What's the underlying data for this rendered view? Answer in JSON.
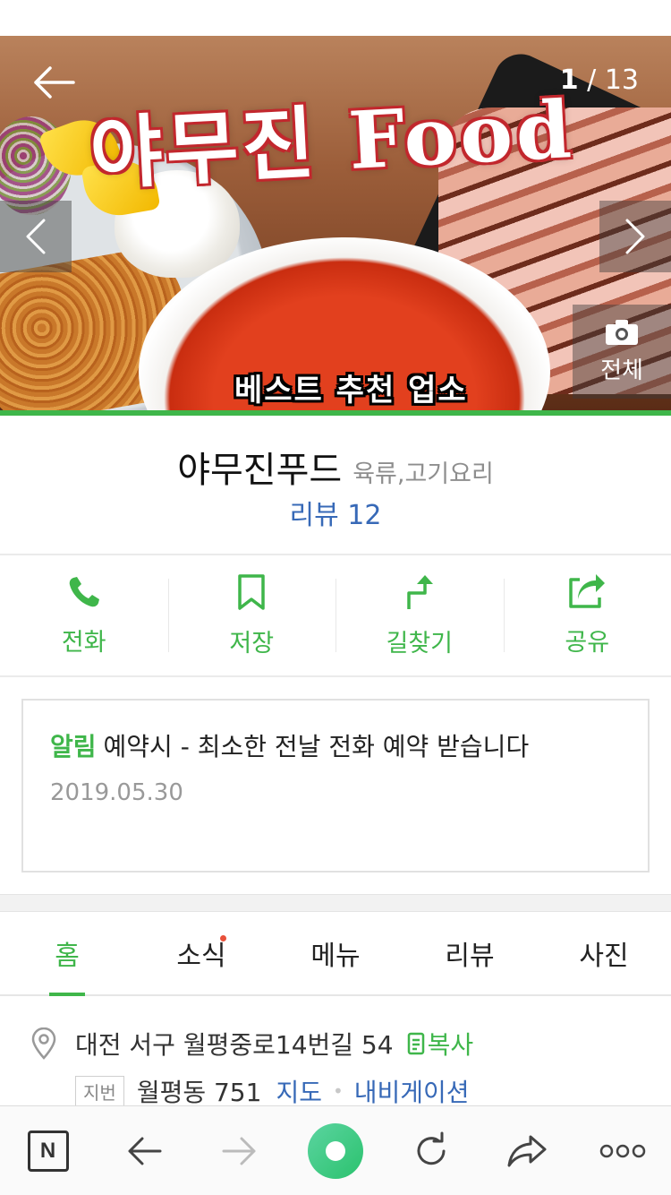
{
  "hero": {
    "title_art": "야무진 Food",
    "caption": "베스트 추천 업소",
    "counter_current": "1",
    "counter_total": "13",
    "all_photos_label": "전체"
  },
  "place": {
    "name": "야무진푸드",
    "category": "육류,고기요리",
    "review_link": "리뷰 12"
  },
  "actions": [
    {
      "label": "전화",
      "icon": "phone-icon"
    },
    {
      "label": "저장",
      "icon": "bookmark-icon"
    },
    {
      "label": "길찾기",
      "icon": "directions-icon"
    },
    {
      "label": "공유",
      "icon": "share-icon"
    }
  ],
  "notice": {
    "tag": "알림",
    "text": "예약시 - 최소한 전날 전화 예약 받습니다",
    "date": "2019.05.30"
  },
  "tabs": [
    {
      "label": "홈",
      "active": true
    },
    {
      "label": "소식",
      "badge": true
    },
    {
      "label": "메뉴"
    },
    {
      "label": "리뷰"
    },
    {
      "label": "사진"
    }
  ],
  "address": {
    "road": "대전 서구 월평중로14번길 54",
    "copy_label": "복사",
    "jibun_tag": "지번",
    "jibun": "월평동 751",
    "map_link": "지도",
    "navi_link": "내비게이션"
  },
  "toolbar": {
    "logo": "N"
  },
  "colors": {
    "accent_green": "#3fb64a",
    "link_blue": "#3769b7",
    "badge_red": "#e8503a"
  }
}
